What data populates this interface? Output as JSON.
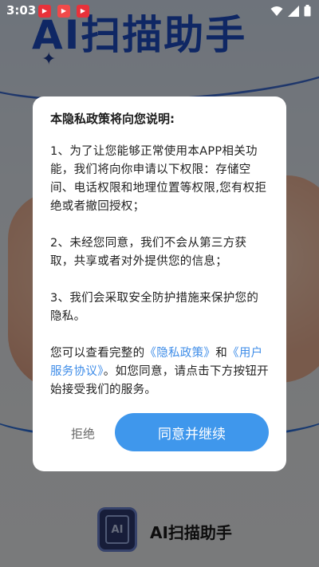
{
  "status_bar": {
    "time": "3:03",
    "notification_icons": [
      "app-icon-1",
      "app-icon-2",
      "app-icon-3"
    ]
  },
  "background": {
    "banner_title": "AI扫描助手",
    "app_name": "AI扫描助手",
    "logo_text": "AI"
  },
  "dialog": {
    "heading": "本隐私政策将向您说明:",
    "para1": "1、为了让您能够正常使用本APP相关功能，我们将向你申请以下权限：存储空间、电话权限和地理位置等权限,您有权拒绝或者撤回授权；",
    "para2": "2、未经您同意，我们不会从第三方获取，共享或者对外提供您的信息；",
    "para3": "3、我们会采取安全防护措施来保护您的隐私。",
    "para4_prefix": "您可以查看完整的",
    "privacy_link": "《隐私政策》",
    "para4_and": "和",
    "terms_link": "《用户服务协议》",
    "para4_suffix": "。如您同意，请点击下方按钮开始接受我们的服务。",
    "reject_label": "拒绝",
    "agree_label": "同意并继续"
  },
  "colors": {
    "accent": "#3f97ec",
    "link": "#3f8de8",
    "brand_blue": "#1f4fc8"
  }
}
